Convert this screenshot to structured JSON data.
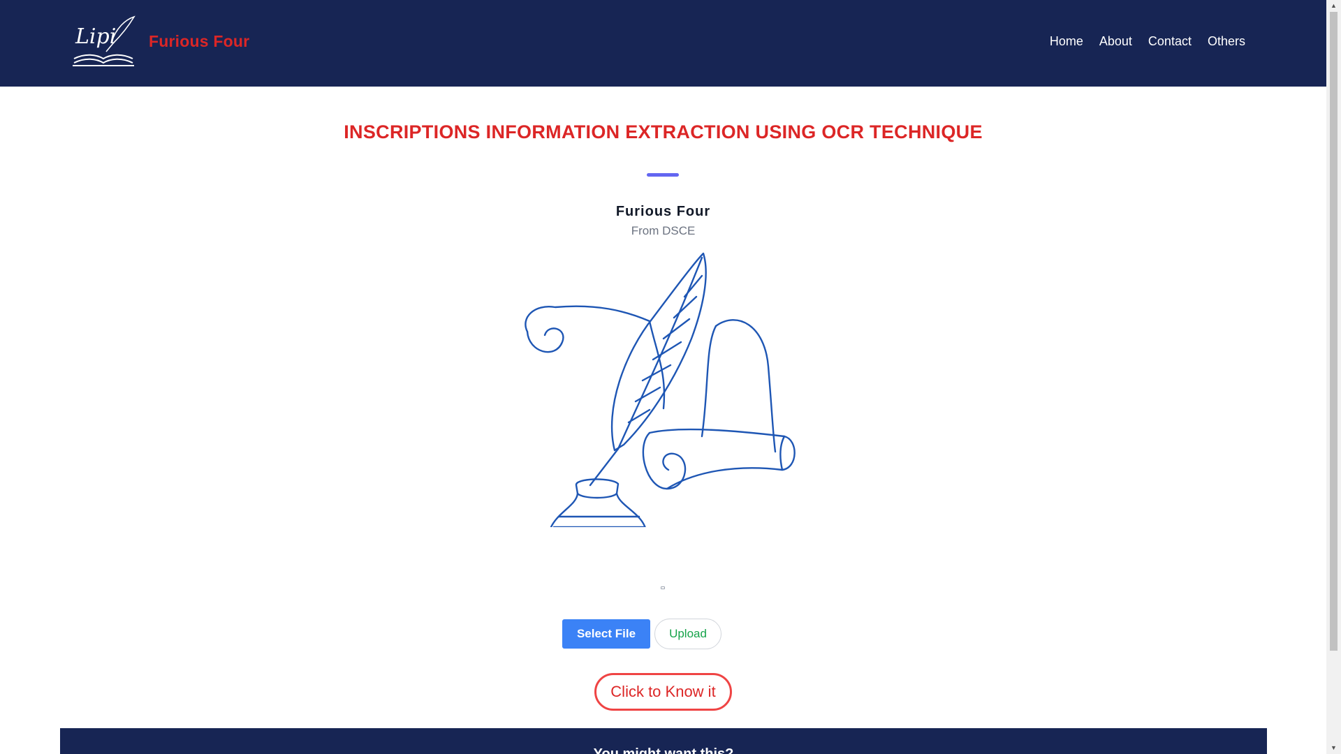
{
  "header": {
    "brand": "Furious Four",
    "logo_text": "Lipi",
    "nav": [
      "Home",
      "About",
      "Contact",
      "Others"
    ]
  },
  "main": {
    "title": "INSCRIPTIONS INFORMATION EXTRACTION USING OCR TECHNIQUE",
    "author": "Furious Four",
    "author_sub": "From DSCE",
    "illustration_icon": "quill-inkwell-scroll-illustration",
    "select_file": "Select File",
    "upload": "Upload",
    "know_button": "Click to Know it"
  },
  "footer": {
    "heading": "You might want this?"
  },
  "colors": {
    "navy": "#172554",
    "accent_red": "#dc2626",
    "button_blue": "#3b82f6",
    "upload_green": "#16a34a",
    "underline_indigo": "#6366f1"
  }
}
